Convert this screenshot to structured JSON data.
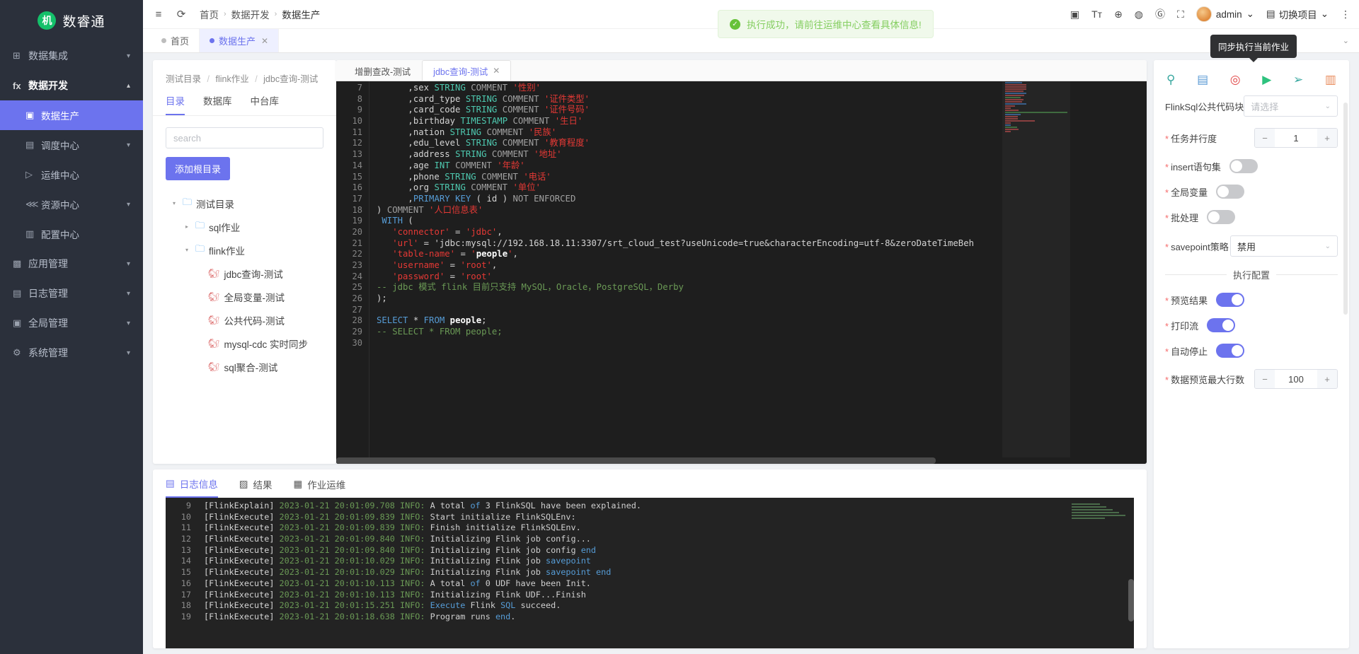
{
  "sidebar": {
    "brand": {
      "logo_char": "机",
      "name": "数睿通"
    },
    "items": [
      {
        "label": "数据集成",
        "icon": "grid-icon",
        "icon_char": "⊞",
        "arrow": "▾",
        "level": 1,
        "state": "normal"
      },
      {
        "label": "数据开发",
        "icon": "function-icon",
        "icon_char": "fx",
        "arrow": "▴",
        "level": 1,
        "state": "expanded"
      },
      {
        "label": "数据生产",
        "icon": "monitor-icon",
        "icon_char": "▣",
        "arrow": "",
        "level": 2,
        "state": "selected"
      },
      {
        "label": "调度中心",
        "icon": "calendar-icon",
        "icon_char": "▤",
        "arrow": "▾",
        "level": 2,
        "state": "normal"
      },
      {
        "label": "运维中心",
        "icon": "send-icon",
        "icon_char": "▷",
        "arrow": "",
        "level": 2,
        "state": "normal"
      },
      {
        "label": "资源中心",
        "icon": "cluster-icon",
        "icon_char": "⋘",
        "arrow": "▾",
        "level": 2,
        "state": "normal"
      },
      {
        "label": "配置中心",
        "icon": "config-icon",
        "icon_char": "▥",
        "arrow": "",
        "level": 2,
        "state": "normal"
      },
      {
        "label": "应用管理",
        "icon": "apps-icon",
        "icon_char": "▩",
        "arrow": "▾",
        "level": 1,
        "state": "normal"
      },
      {
        "label": "日志管理",
        "icon": "log-icon",
        "icon_char": "▤",
        "arrow": "▾",
        "level": 1,
        "state": "normal"
      },
      {
        "label": "全局管理",
        "icon": "global-icon",
        "icon_char": "▣",
        "arrow": "▾",
        "level": 1,
        "state": "normal"
      },
      {
        "label": "系统管理",
        "icon": "gear-icon",
        "icon_char": "⚙",
        "arrow": "▾",
        "level": 1,
        "state": "normal"
      }
    ]
  },
  "topbar": {
    "collapse_icon": "≡",
    "refresh_icon": "⟳",
    "breadcrumb": [
      "首页",
      "数据开发",
      "数据生产"
    ],
    "separator": "›",
    "right_icons": [
      {
        "name": "image-add-icon",
        "char": "▣"
      },
      {
        "name": "font-size-icon",
        "char": "Tт"
      },
      {
        "name": "globe-icon",
        "char": "⊕"
      },
      {
        "name": "github-icon",
        "char": "◍"
      },
      {
        "name": "gitee-icon",
        "char": "Ⓖ"
      },
      {
        "name": "fullscreen-icon",
        "char": "⛶"
      }
    ],
    "user_name": "admin",
    "user_chevron": "⌄",
    "project_icon": "▤",
    "project_label": "切换项目",
    "project_chevron": "⌄",
    "more_icon": "⋮"
  },
  "toast": {
    "icon": "✓",
    "message": "执行成功，请前往运维中心查看具体信息!"
  },
  "page_tabs": [
    {
      "label": "首页",
      "active": false,
      "closable": false
    },
    {
      "label": "数据生产",
      "active": true,
      "closable": true,
      "close_char": "✕"
    }
  ],
  "tree": {
    "breadcrumb": [
      "测试目录",
      "flink作业",
      "jdbc查询-测试"
    ],
    "separator": "/",
    "tabs": [
      {
        "label": "目录",
        "active": true
      },
      {
        "label": "数据库",
        "active": false
      },
      {
        "label": "中台库",
        "active": false
      }
    ],
    "search_placeholder": "search",
    "search_value": "",
    "add_root_label": "添加根目录",
    "nodes": [
      {
        "label": "测试目录",
        "type": "folder",
        "indent": 0,
        "caret": "▾",
        "icon": "folder-icon"
      },
      {
        "label": "sql作业",
        "type": "folder",
        "indent": 1,
        "caret": "▸",
        "icon": "folder-icon"
      },
      {
        "label": "flink作业",
        "type": "folder",
        "indent": 1,
        "caret": "▾",
        "icon": "folder-icon"
      },
      {
        "label": "jdbc查询-测试",
        "type": "file",
        "indent": 2,
        "caret": "",
        "icon": "flink-file-icon"
      },
      {
        "label": "全局变量-测试",
        "type": "file",
        "indent": 2,
        "caret": "",
        "icon": "flink-file-icon"
      },
      {
        "label": "公共代码-测试",
        "type": "file",
        "indent": 2,
        "caret": "",
        "icon": "flink-file-icon"
      },
      {
        "label": "mysql-cdc 实时同步",
        "type": "file",
        "indent": 2,
        "caret": "",
        "icon": "flink-file-icon"
      },
      {
        "label": "sql聚合-测试",
        "type": "file",
        "indent": 2,
        "caret": "",
        "icon": "flink-file-icon"
      }
    ]
  },
  "editor": {
    "tabs": [
      {
        "label": "增删查改-测试",
        "active": false,
        "closable": false
      },
      {
        "label": "jdbc查询-测试",
        "active": true,
        "closable": true,
        "close_char": "✕"
      }
    ],
    "first_line_number": 7,
    "lines": [
      {
        "n": 7,
        "text": "      ,sex STRING COMMENT '性别'"
      },
      {
        "n": 8,
        "text": "      ,card_type STRING COMMENT '证件类型'"
      },
      {
        "n": 9,
        "text": "      ,card_code STRING COMMENT '证件号码'"
      },
      {
        "n": 10,
        "text": "      ,birthday TIMESTAMP COMMENT '生日'"
      },
      {
        "n": 11,
        "text": "      ,nation STRING COMMENT '民族'"
      },
      {
        "n": 12,
        "text": "      ,edu_level STRING COMMENT '教育程度'"
      },
      {
        "n": 13,
        "text": "      ,address STRING COMMENT '地址'"
      },
      {
        "n": 14,
        "text": "      ,age INT COMMENT '年龄'"
      },
      {
        "n": 15,
        "text": "      ,phone STRING COMMENT '电话'"
      },
      {
        "n": 16,
        "text": "      ,org STRING COMMENT '单位'"
      },
      {
        "n": 17,
        "text": "      ,PRIMARY KEY ( id ) NOT ENFORCED"
      },
      {
        "n": 18,
        "text": ") COMMENT '人口信息表'"
      },
      {
        "n": 19,
        "text": " WITH ("
      },
      {
        "n": 20,
        "text": "   'connector' = 'jdbc',"
      },
      {
        "n": 21,
        "text": "   'url' = 'jdbc:mysql://192.168.18.11:3307/srt_cloud_test?useUnicode=true&characterEncoding=utf-8&zeroDateTimeBeh"
      },
      {
        "n": 22,
        "text": "   'table-name' = 'people',"
      },
      {
        "n": 23,
        "text": "   'username' = 'root',"
      },
      {
        "n": 24,
        "text": "   'password' = 'root'"
      },
      {
        "n": 25,
        "text": "-- jdbc 模式 flink 目前只支持 MySQL，Oracle，PostgreSQL，Derby"
      },
      {
        "n": 26,
        "text": ");"
      },
      {
        "n": 27,
        "text": ""
      },
      {
        "n": 28,
        "text": "SELECT * FROM people;"
      },
      {
        "n": 29,
        "text": "-- SELECT * FROM people;"
      },
      {
        "n": 30,
        "text": ""
      }
    ]
  },
  "log": {
    "tabs": [
      {
        "label": "日志信息",
        "icon": "log-info-icon",
        "icon_char": "▤",
        "active": true
      },
      {
        "label": "结果",
        "icon": "result-icon",
        "icon_char": "▨",
        "active": false
      },
      {
        "label": "作业运维",
        "icon": "job-ops-icon",
        "icon_char": "▦",
        "active": false
      }
    ],
    "lines": [
      {
        "n": 9,
        "text": "[FlinkExplain] 2023-01-21 20:01:09.708 INFO: A total of 3 FlinkSQL have been explained."
      },
      {
        "n": 10,
        "text": "[FlinkExecute] 2023-01-21 20:01:09.839 INFO: Start initialize FlinkSQLEnv:"
      },
      {
        "n": 11,
        "text": "[FlinkExecute] 2023-01-21 20:01:09.839 INFO: Finish initialize FlinkSQLEnv."
      },
      {
        "n": 12,
        "text": "[FlinkExecute] 2023-01-21 20:01:09.840 INFO: Initializing Flink job config..."
      },
      {
        "n": 13,
        "text": "[FlinkExecute] 2023-01-21 20:01:09.840 INFO: Initializing Flink job config end"
      },
      {
        "n": 14,
        "text": "[FlinkExecute] 2023-01-21 20:01:10.029 INFO: Initializing Flink job savepoint"
      },
      {
        "n": 15,
        "text": "[FlinkExecute] 2023-01-21 20:01:10.029 INFO: Initializing Flink job savepoint end"
      },
      {
        "n": 16,
        "text": "[FlinkExecute] 2023-01-21 20:01:10.113 INFO: A total of 0 UDF have been Init."
      },
      {
        "n": 17,
        "text": "[FlinkExecute] 2023-01-21 20:01:10.113 INFO: Initializing Flink UDF...Finish"
      },
      {
        "n": 18,
        "text": "[FlinkExecute] 2023-01-21 20:01:15.251 INFO: Execute Flink SQL succeed."
      },
      {
        "n": 19,
        "text": "[FlinkExecute] 2023-01-21 20:01:18.638 INFO: Program runs end."
      }
    ]
  },
  "config": {
    "tooltip": "同步执行当前作业",
    "tools": [
      {
        "name": "magic-wand-icon",
        "char": "⚲",
        "color": "#3aa8a0"
      },
      {
        "name": "save-icon",
        "char": "▤",
        "color": "#5b9bd5"
      },
      {
        "name": "check-shield-icon",
        "char": "◎",
        "color": "#e24a4a"
      },
      {
        "name": "run-icon",
        "char": "▶",
        "color": "#2ec27e"
      },
      {
        "name": "submit-icon",
        "char": "➢",
        "color": "#3aa8a0"
      },
      {
        "name": "clear-icon",
        "char": "▥",
        "color": "#e88a5a"
      }
    ],
    "fields": [
      {
        "name": "flinksql-common-code-block",
        "label": "FlinkSql公共代码块",
        "required": false,
        "type": "select",
        "value": "",
        "placeholder": "请选择",
        "chevron": "⌄"
      },
      {
        "name": "task-parallelism",
        "label": "任务并行度",
        "required": true,
        "type": "stepper",
        "value": "1",
        "minus": "−",
        "plus": "+"
      },
      {
        "name": "insert-statement-set",
        "label": "insert语句集",
        "required": true,
        "type": "switch",
        "value": false
      },
      {
        "name": "global-variable",
        "label": "全局变量",
        "required": true,
        "type": "switch",
        "value": false
      },
      {
        "name": "batch-processing",
        "label": "批处理",
        "required": true,
        "type": "switch",
        "value": false
      },
      {
        "name": "savepoint-strategy",
        "label": "savepoint策略",
        "required": true,
        "type": "select",
        "value": "禁用",
        "placeholder": "",
        "chevron": "⌄"
      }
    ],
    "section_title": "执行配置",
    "exec_fields": [
      {
        "name": "preview-result",
        "label": "预览结果",
        "required": true,
        "type": "switch",
        "value": true
      },
      {
        "name": "print-stream",
        "label": "打印流",
        "required": true,
        "type": "switch",
        "value": true
      },
      {
        "name": "auto-stop",
        "label": "自动停止",
        "required": true,
        "type": "switch",
        "value": true
      },
      {
        "name": "max-preview-rows",
        "label": "数据预览最大行数",
        "required": true,
        "type": "stepper",
        "value": "100",
        "minus": "−",
        "plus": "+"
      }
    ]
  },
  "colors": {
    "accent": "#6c73ee",
    "sidebar_bg": "#2b303b",
    "success": "#67c23a",
    "required": "#f56c6c",
    "editor_bg": "#1e1e1e"
  }
}
